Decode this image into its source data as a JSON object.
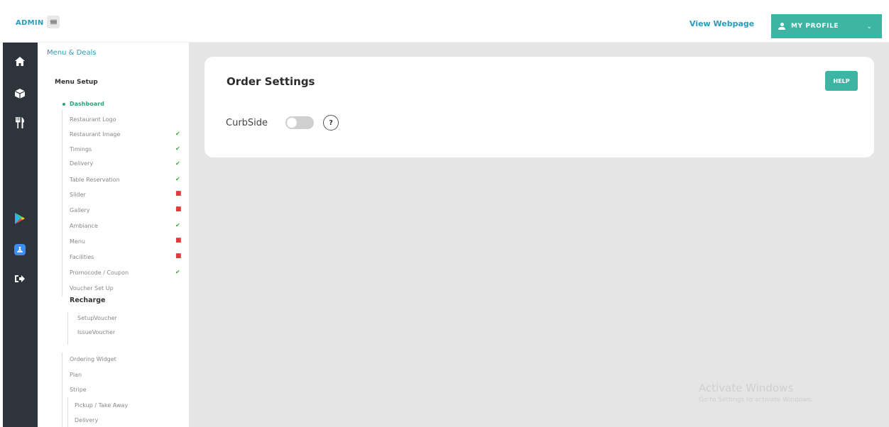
{
  "header": {
    "brand": "ADMIN",
    "view_webpage": "View Webpage",
    "profile_label": "MY PROFILE",
    "caret": "⌄"
  },
  "rail": {
    "icons": [
      "home-icon",
      "box-icon",
      "restaurant-icon",
      "play-store-icon",
      "app-store-icon",
      "logout-icon"
    ]
  },
  "menu": {
    "section": "Menu & Deals",
    "setup": "Menu Setup",
    "items": [
      {
        "label": "Dashboard",
        "status": ""
      },
      {
        "label": "Restaurant Logo",
        "status": ""
      },
      {
        "label": "Restaurant Image",
        "status": "✔"
      },
      {
        "label": "Timings",
        "status": "✔"
      },
      {
        "label": "Delivery",
        "status": "✔"
      },
      {
        "label": "Table Reservation",
        "status": "✔"
      },
      {
        "label": "Slider",
        "status": "■"
      },
      {
        "label": "Gallery",
        "status": "■"
      },
      {
        "label": "Ambiance",
        "status": "✔"
      },
      {
        "label": "Menu",
        "status": "■"
      },
      {
        "label": "Facilities",
        "status": "■"
      },
      {
        "label": "Promocode / Coupon",
        "status": "✔"
      },
      {
        "label": "Voucher Set Up",
        "status": ""
      }
    ],
    "recharge": "Recharge",
    "recharge_items": [
      "SetupVoucher",
      "IssueVoucher"
    ],
    "other_items": [
      "Ordering Widget",
      "Plan",
      "Stripe"
    ],
    "stripe_items": [
      "Pickup / Take Away",
      "Delivery"
    ]
  },
  "card": {
    "title": "Order Settings",
    "help": "HELP",
    "curbside_label": "CurbSide",
    "curbside_on": false,
    "question": "?"
  },
  "watermark": {
    "title": "Activate Windows",
    "subtitle": "Go to Settings to activate Windows."
  },
  "colors": {
    "accent": "#3db5a5",
    "link": "#2a9bb8",
    "rail": "#2e343b",
    "ok": "#3aa63a",
    "bad": "#e23b3b"
  }
}
